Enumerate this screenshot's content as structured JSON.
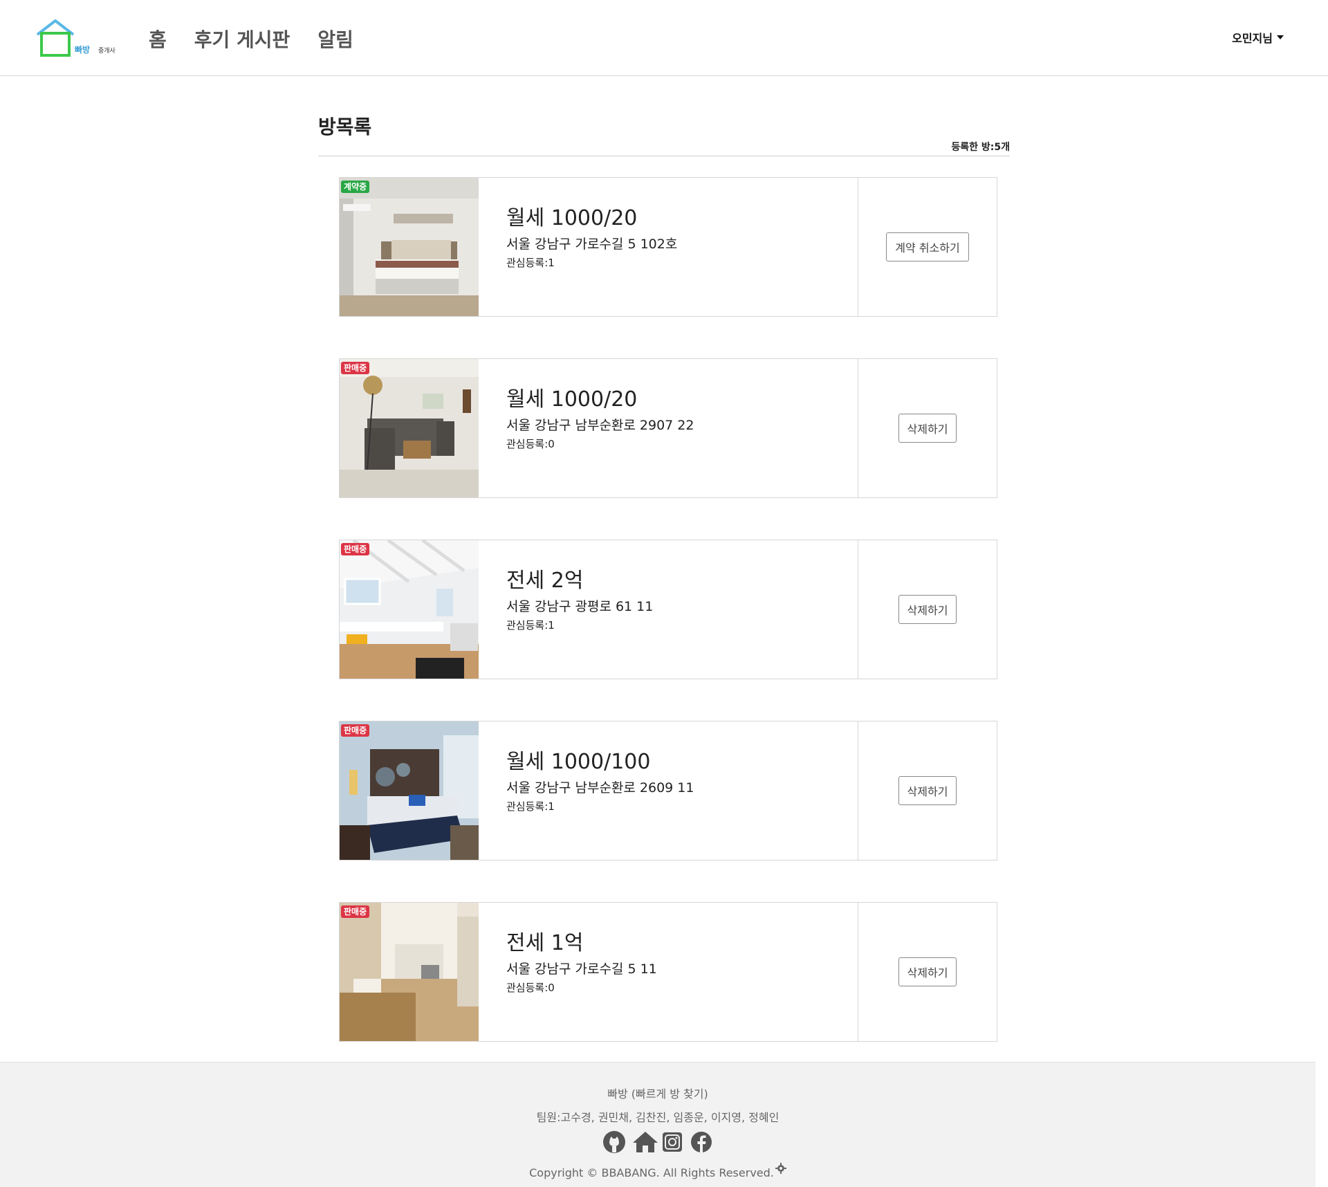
{
  "header": {
    "logo_text": "빠방 중개사",
    "nav": [
      {
        "label": "홈"
      },
      {
        "label": "후기 게시판"
      },
      {
        "label": "알림"
      }
    ],
    "user_menu": "오민지님"
  },
  "main": {
    "title": "방목록",
    "room_count": "등록한 방:5개",
    "rooms": [
      {
        "status": "계약중",
        "status_color": "#28a745",
        "price": "월세 1000/20",
        "address": "서울 강남구 가로수길 5 102호",
        "likes": "관심등록:1",
        "action": "계약 취소하기",
        "photo": "bedroom-photo"
      },
      {
        "status": "판매중",
        "status_color": "#dc3545",
        "price": "월세 1000/20",
        "address": "서울 강남구 남부순환로 2907 22",
        "likes": "관심등록:0",
        "action": "삭제하기",
        "photo": "living-room-photo"
      },
      {
        "status": "판매중",
        "status_color": "#dc3545",
        "price": "전세 2억",
        "address": "서울 강남구 광평로 61 11",
        "likes": "관심등록:1",
        "action": "삭제하기",
        "photo": "attic-room-photo"
      },
      {
        "status": "판매중",
        "status_color": "#dc3545",
        "price": "월세 1000/100",
        "address": "서울 강남구 남부순환로 2609 11",
        "likes": "관심등록:1",
        "action": "삭제하기",
        "photo": "hotel-bedroom-photo"
      },
      {
        "status": "판매중",
        "status_color": "#dc3545",
        "price": "전세 1억",
        "address": "서울 강남구 가로수길 5 11",
        "likes": "관심등록:0",
        "action": "삭제하기",
        "photo": "kitchen-photo"
      }
    ]
  },
  "footer": {
    "site": "빠방 (빠르게 방 찾기)",
    "team": "팀원:고수경, 권민채, 김찬진, 임종운, 이지영, 정혜인",
    "icons": [
      "github-icon",
      "home-icon",
      "instagram-icon",
      "facebook-icon"
    ],
    "copyright": "Copyright © BBABANG. All Rights Reserved.",
    "settings_icon": "gear-icon"
  }
}
